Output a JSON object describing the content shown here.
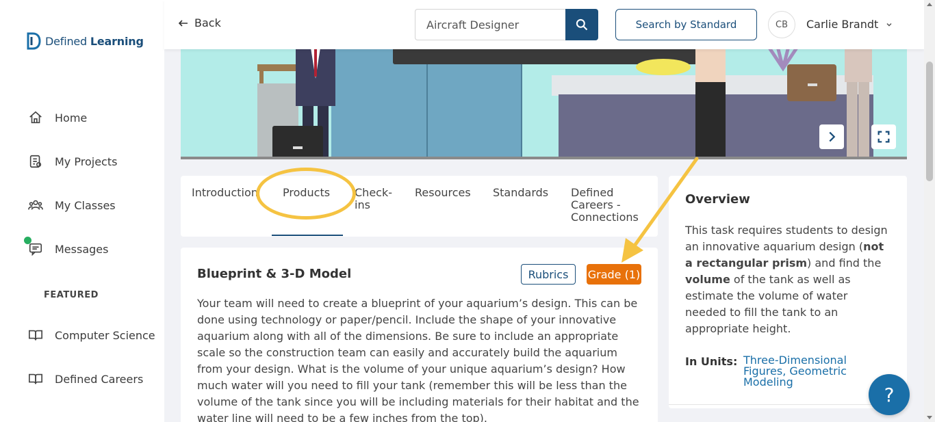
{
  "sidebar": {
    "logo": {
      "prefix": "Defined ",
      "bold": "Learning"
    },
    "items": [
      {
        "label": "Home",
        "icon": "home-icon"
      },
      {
        "label": "My Projects",
        "icon": "projects-icon"
      },
      {
        "label": "My Classes",
        "icon": "classes-icon"
      },
      {
        "label": "Messages",
        "icon": "messages-icon"
      }
    ],
    "featured_label": "FEATURED",
    "featured_items": [
      {
        "label": "Computer Science",
        "icon": "book-icon"
      },
      {
        "label": "Defined Careers",
        "icon": "book-icon"
      }
    ]
  },
  "header": {
    "back_label": "Back",
    "search_value": "Aircraft Designer",
    "search_by_standard": "Search by Standard",
    "avatar_initials": "CB",
    "user_name": "Carlie Brandt"
  },
  "tabs": [
    {
      "label": "Introduction"
    },
    {
      "label": "Products"
    },
    {
      "label": "Check-ins"
    },
    {
      "label": "Resources"
    },
    {
      "label": "Standards"
    },
    {
      "label": "Defined Careers - Connections"
    }
  ],
  "product": {
    "title": "Blueprint & 3-D Model",
    "rubrics_label": "Rubrics",
    "grade_label": "Grade (1)",
    "body": "Your team will need to create a blueprint of your aquarium’s design. This can be done using technology or paper/pencil. Include the shape of your innovative aquarium along with all of the dimensions. Be sure to include an appropriate scale so the construction team can easily and accurately build the aquarium from your design. What is the volume of your unique aquarium’s design? How much water will you need to fill your tank (remember this will be less than the volume of the tank since you will be including materials for their habitat and the water line will need to be a few inches from the top)."
  },
  "overview": {
    "title": "Overview",
    "text_1": "This task requires students to design an innovative aquarium design (",
    "bold_1": "not a rectangular prism",
    "text_2": ") and find the ",
    "bold_2": "volume",
    "text_3": " of the tank as well as estimate the volume of water needed to fill the tank to an appropriate height.",
    "units_label": "In Units:",
    "units_value": "Three-Dimensional Figures, Geometric Modeling"
  },
  "help_label": "?",
  "colors": {
    "brand": "#1a4e7a",
    "link": "#1a6fa8",
    "grade": "#e8710a",
    "annotation": "#f5c342",
    "online_dot": "#27ae60"
  }
}
